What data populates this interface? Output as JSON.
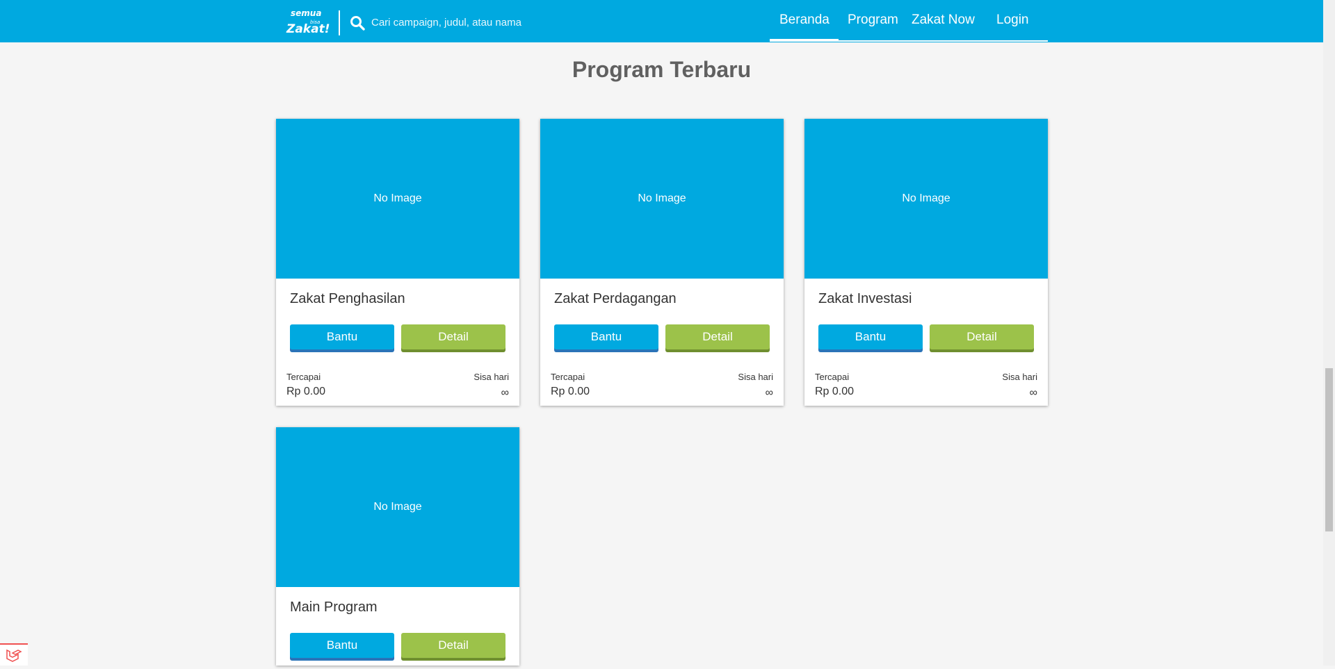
{
  "header": {
    "logo_alt": "semua bisa Zakat!",
    "search": {
      "placeholder": "Cari campaign, judul, atau nama",
      "value": ""
    },
    "nav": [
      {
        "label": "Beranda",
        "active": true
      },
      {
        "label": "Program",
        "active": false
      },
      {
        "label": "Zakat Now",
        "active": false
      },
      {
        "label": "Login",
        "active": false
      }
    ]
  },
  "main": {
    "title": "Program Terbaru",
    "cards": [
      {
        "image_text": "No Image",
        "title": "Zakat Penghasilan",
        "bantu_label": "Bantu",
        "detail_label": "Detail",
        "reached_label": "Tercapai",
        "reached_value": "Rp 0.00",
        "days_label": "Sisa hari",
        "days_value": "∞"
      },
      {
        "image_text": "No Image",
        "title": "Zakat Perdagangan",
        "bantu_label": "Bantu",
        "detail_label": "Detail",
        "reached_label": "Tercapai",
        "reached_value": "Rp 0.00",
        "days_label": "Sisa hari",
        "days_value": "∞"
      },
      {
        "image_text": "No Image",
        "title": "Zakat Investasi",
        "bantu_label": "Bantu",
        "detail_label": "Detail",
        "reached_label": "Tercapai",
        "reached_value": "Rp 0.00",
        "days_label": "Sisa hari",
        "days_value": "∞"
      },
      {
        "image_text": "No Image",
        "title": "Main Program",
        "bantu_label": "Bantu",
        "detail_label": "Detail"
      }
    ]
  },
  "colors": {
    "primary": "#00a9e0",
    "detail_button": "#9cc24a",
    "background": "#f5f5f5"
  },
  "icons": {
    "search": "search-icon",
    "debug": "laravel-debugbar-icon"
  }
}
